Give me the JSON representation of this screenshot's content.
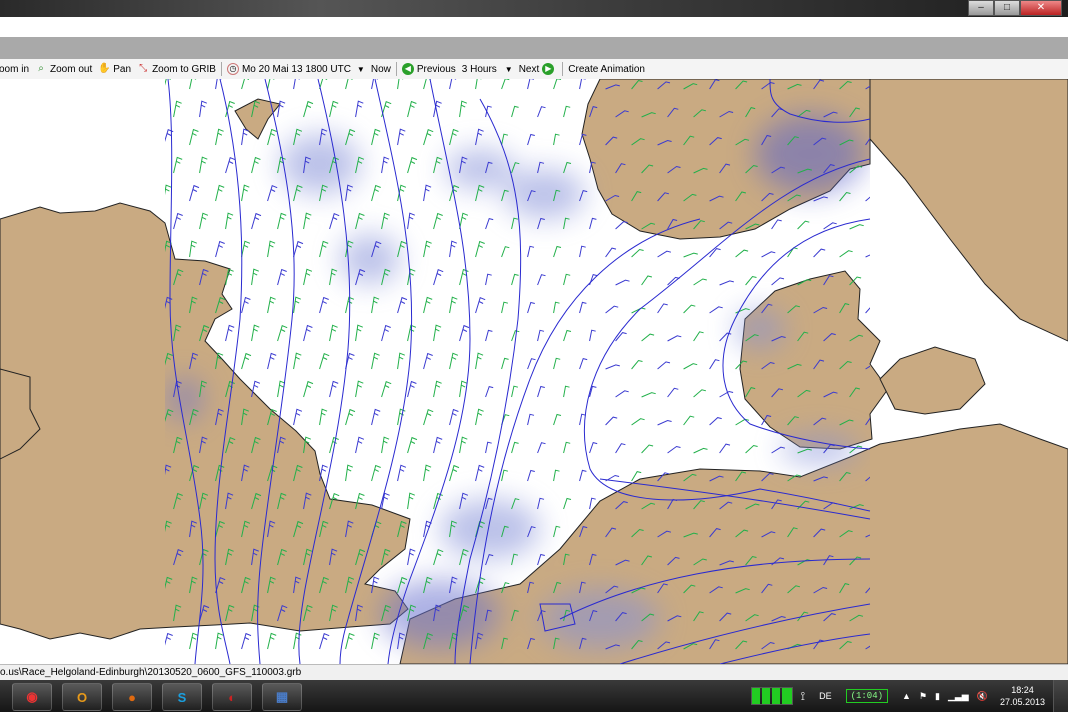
{
  "window": {
    "controls": [
      "–",
      "□",
      "✕"
    ]
  },
  "toolbar": {
    "zoom_in": "oom in",
    "zoom_out": "Zoom out",
    "pan": "Pan",
    "zoom_to_grib": "Zoom to GRIB",
    "datetime": "Mo 20 Mai 13 1800 UTC",
    "now": "Now",
    "previous": "Previous",
    "step": "3 Hours",
    "next": "Next",
    "create_animation": "Create Animation"
  },
  "status": {
    "path": "o.us\\Race_Helgoland-Edinburgh\\20130520_0600_GFS_110003.grb"
  },
  "taskbar": {
    "apps": [
      {
        "name": "start-icon",
        "glyph": "◉",
        "color": "#e33"
      },
      {
        "name": "outlook-icon",
        "glyph": "O",
        "color": "#e89a1a"
      },
      {
        "name": "firefox-icon",
        "glyph": "●",
        "color": "#e06a10"
      },
      {
        "name": "skype-icon",
        "glyph": "S",
        "color": "#1aa0e0"
      },
      {
        "name": "app-red-icon",
        "glyph": "◐",
        "color": "#c22"
      },
      {
        "name": "app-blue-icon",
        "glyph": "▦",
        "color": "#4a7cc7"
      }
    ],
    "language": "DE",
    "battery": "(1:04)",
    "time": "18:24",
    "date": "27.05.2013"
  },
  "colors": {
    "land": "#c9aa82",
    "isobar": "#2a2ad0",
    "rain": "#8490d8",
    "wind_green": "#22b04a",
    "wind_blue": "#3a3ad0"
  }
}
